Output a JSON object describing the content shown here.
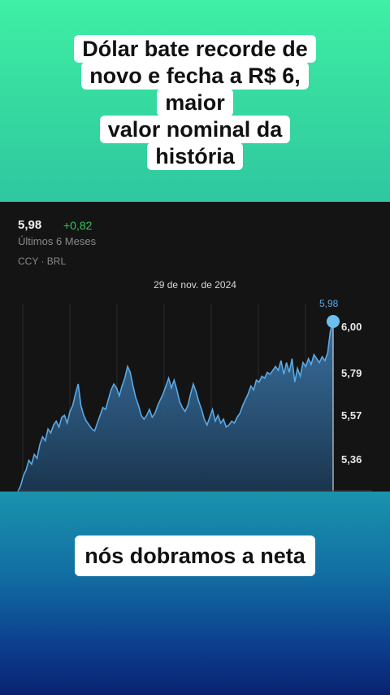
{
  "headline": {
    "lines": [
      "Dólar bate recorde de",
      "novo e fecha a R$ 6,",
      "maior",
      "valor nominal da",
      "história"
    ]
  },
  "quote": {
    "price": "5,98",
    "change": "+0,82",
    "period": "Últimos 6 Meses",
    "ticker": "CCY · BRL",
    "selected_date": "29 de nov. de 2024",
    "selected_value": "5,98",
    "colors": {
      "positive": "#36c55a",
      "line": "#5aa9e6",
      "background": "#141414"
    }
  },
  "chart_data": {
    "type": "area",
    "y_ticks": [
      "6,00",
      "5,79",
      "5,57",
      "5,36"
    ],
    "ylim": [
      5.16,
      6.08
    ],
    "series": [
      {
        "values": [
          5.16,
          5.19,
          5.24,
          5.27,
          5.32,
          5.3,
          5.35,
          5.33,
          5.4,
          5.44,
          5.42,
          5.48,
          5.46,
          5.5,
          5.52,
          5.49,
          5.54,
          5.55,
          5.51,
          5.57,
          5.6,
          5.66,
          5.71,
          5.6,
          5.55,
          5.52,
          5.5,
          5.48,
          5.47,
          5.51,
          5.55,
          5.59,
          5.58,
          5.63,
          5.68,
          5.71,
          5.69,
          5.65,
          5.7,
          5.74,
          5.8,
          5.77,
          5.7,
          5.64,
          5.6,
          5.55,
          5.53,
          5.55,
          5.58,
          5.54,
          5.56,
          5.6,
          5.63,
          5.66,
          5.7,
          5.74,
          5.69,
          5.73,
          5.68,
          5.62,
          5.59,
          5.57,
          5.6,
          5.66,
          5.71,
          5.67,
          5.62,
          5.58,
          5.53,
          5.5,
          5.54,
          5.58,
          5.52,
          5.55,
          5.51,
          5.53,
          5.49,
          5.5,
          5.52,
          5.51,
          5.54,
          5.56,
          5.6,
          5.63,
          5.66,
          5.7,
          5.68,
          5.73,
          5.72,
          5.75,
          5.74,
          5.77,
          5.76,
          5.78,
          5.8,
          5.78,
          5.83,
          5.76,
          5.82,
          5.77,
          5.84,
          5.72,
          5.79,
          5.75,
          5.82,
          5.8,
          5.84,
          5.81,
          5.86,
          5.84,
          5.82,
          5.85,
          5.83,
          5.87,
          5.98,
          6.03
        ]
      }
    ]
  },
  "bottom_caption": "nós dobramos a neta"
}
